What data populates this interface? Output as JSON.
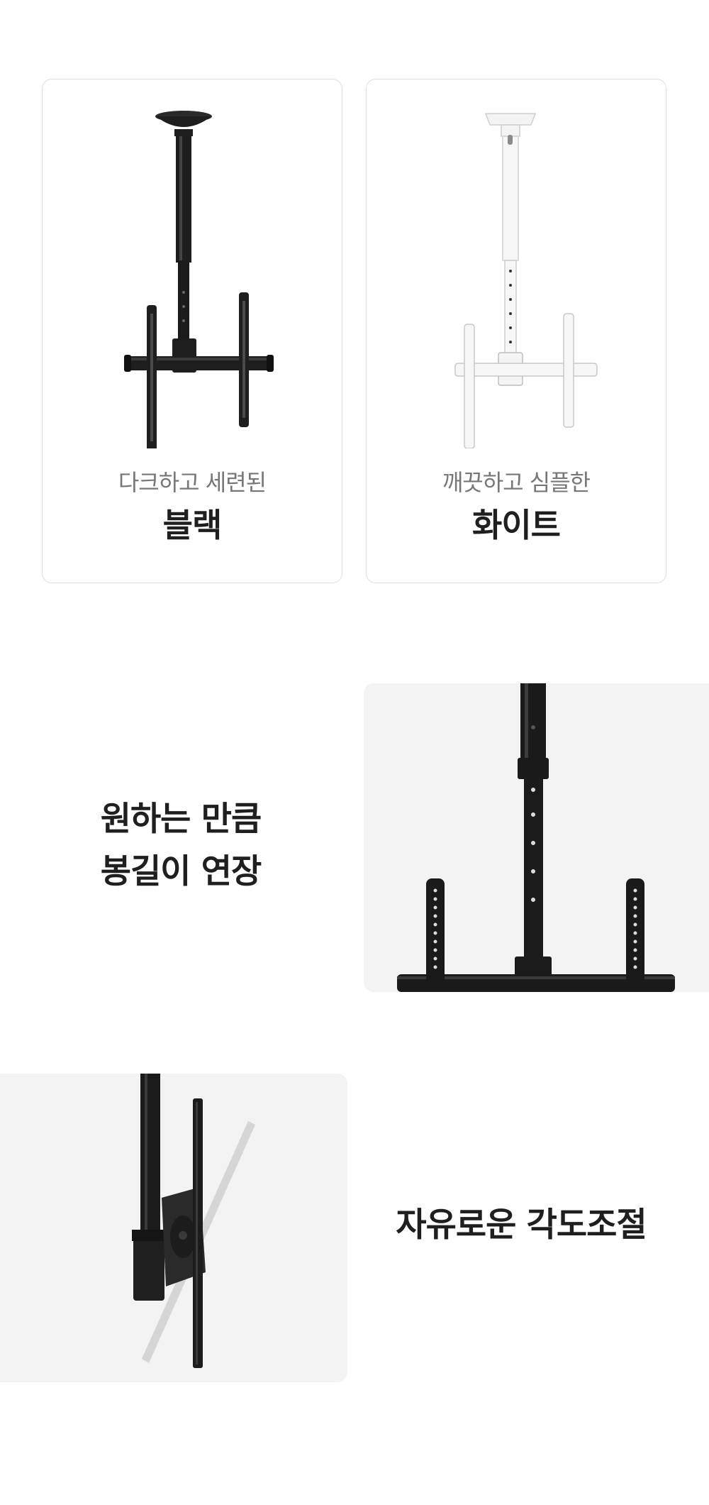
{
  "products": [
    {
      "subtitle": "다크하고 세련된",
      "title": "블랙",
      "color": "#1e1e1e"
    },
    {
      "subtitle": "깨끗하고 심플한",
      "title": "화이트",
      "color": "#f7f7f7"
    }
  ],
  "features": {
    "extension": {
      "line1": "원하는 만큼",
      "line2": "봉길이 연장"
    },
    "tilt": {
      "label": "자유로운 각도조절"
    }
  },
  "colors": {
    "card_border": "#dedede",
    "panel_bg": "#f3f3f3",
    "text_dark": "#1f1f1f",
    "text_gray": "#777777"
  }
}
